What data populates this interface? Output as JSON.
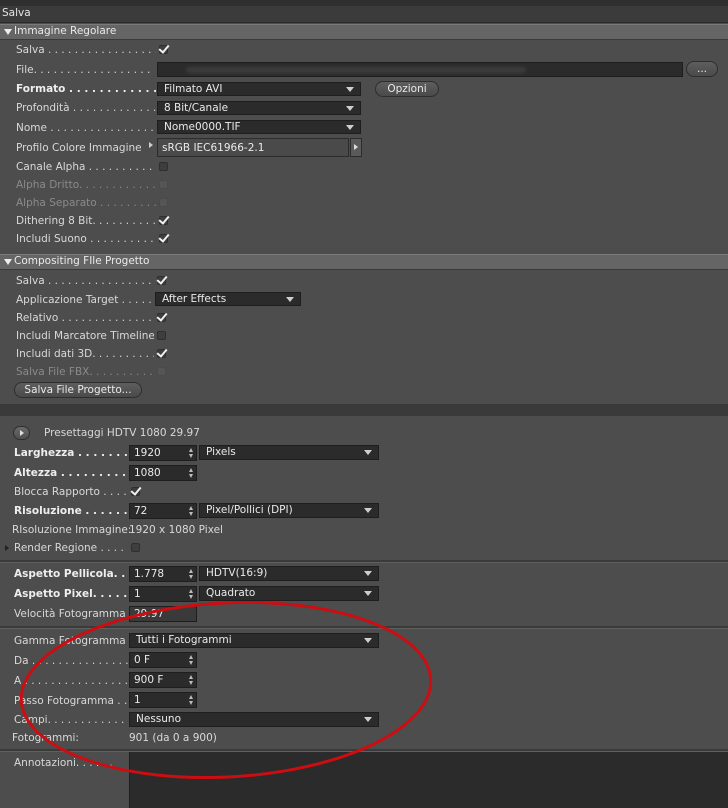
{
  "title": "Salva",
  "section1": {
    "header": "Immagine Regolare",
    "salva_label": "Salva . . . . . . . . . . . . . . . . .",
    "file_label": "File. . . . . . . . . . . . . . . . . .",
    "file_button": "...",
    "formato_label": "Formato . . . . . . . . . . . . . .",
    "formato_value": "Filmato AVI",
    "opzioni_button": "Opzioni",
    "profondita_label": "Profondità . . . . . . . . . . . . .",
    "profondita_value": "8 Bit/Canale",
    "nome_label": "Nome . . . . . . . . . . . . . . . .",
    "nome_value": "Nome0000.TIF",
    "profilo_label": "Profilo Colore Immagine",
    "profilo_value": "sRGB IEC61966-2.1",
    "canale_alpha_label": "Canale Alpha . . . . . . . . . . .",
    "alpha_dritto_label": "Alpha Dritto. . . . . . . . . . . . .",
    "alpha_separato_label": "Alpha Separato . . . . . . . . . .",
    "dithering_label": "Dithering 8 Bit. . . . . . . . . . .",
    "includi_suono_label": "Includi Suono . . . . . . . . . . ."
  },
  "section2": {
    "header": "Compositing FIle Progetto",
    "salva_label": "Salva . . . . . . . . . . . . . . . . .",
    "applicazione_label": "Applicazione Target . . . . . . .",
    "applicazione_value": "After Effects",
    "relativo_label": "Relativo . . . . . . . . . . . . . . .",
    "marcatore_label": "Includi Marcatore Timeline",
    "dati3d_label": "Includi dati 3D. . . . . . . . . . .",
    "fbx_label": "Salva File FBX. . . . . . . . . . .",
    "salva_file_button": "Salva File Progetto..."
  },
  "output": {
    "preset_label": "Presettaggi HDTV 1080 29.97",
    "larghezza_label": "Larghezza . . . . . . . . .",
    "larghezza_value": "1920",
    "larghezza_unit": "Pixels",
    "altezza_label": "Altezza . . . . . . . . . . .",
    "altezza_value": "1080",
    "blocca_label": "Blocca Rapporto . . . .",
    "risoluzione_label": "Risoluzione . . . . . . . .",
    "risoluzione_value": "72",
    "risoluzione_unit": "Pixel/Pollici (DPI)",
    "risoluzione_immagine_label": "RIsoluzione Immagine:",
    "risoluzione_immagine_value": "1920 x 1080 Pixel",
    "render_regione_label": "Render Regione . . . .",
    "aspetto_pellicola_label": "Aspetto Pellicola. . . .",
    "aspetto_pellicola_value": "1.778",
    "aspetto_pellicola_unit": "HDTV(16:9)",
    "aspetto_pixel_label": "Aspetto Pixel. . . . . . . .",
    "aspetto_pixel_value": "1",
    "aspetto_pixel_unit": "Quadrato",
    "velocita_label": "Velocità Fotogramma",
    "velocita_value": "29.97",
    "gamma_label": "Gamma Fotogramma",
    "gamma_value": "Tutti i Fotogrammi",
    "da_label": "Da . . . . . . . . . . . . . . . .",
    "da_value": "0 F",
    "a_label": "A . . . . . . . . . . . . . . . . .",
    "a_value": "900 F",
    "passo_label": "Passo Fotogramma . .",
    "passo_value": "1",
    "campi_label": "Campi. . . . . . . . . . . . . .",
    "campi_value": "Nessuno",
    "fotogrammi_label": "Fotogrammi:",
    "fotogrammi_value": "901 (da 0 a 900)",
    "annotazioni_label": "Annotazioni. . . . . ."
  },
  "colors": {
    "panel": "#4d4d4d",
    "section_header": "#656565",
    "field": "#2b2b2b",
    "annotation_ellipse": "#cc0d12"
  }
}
